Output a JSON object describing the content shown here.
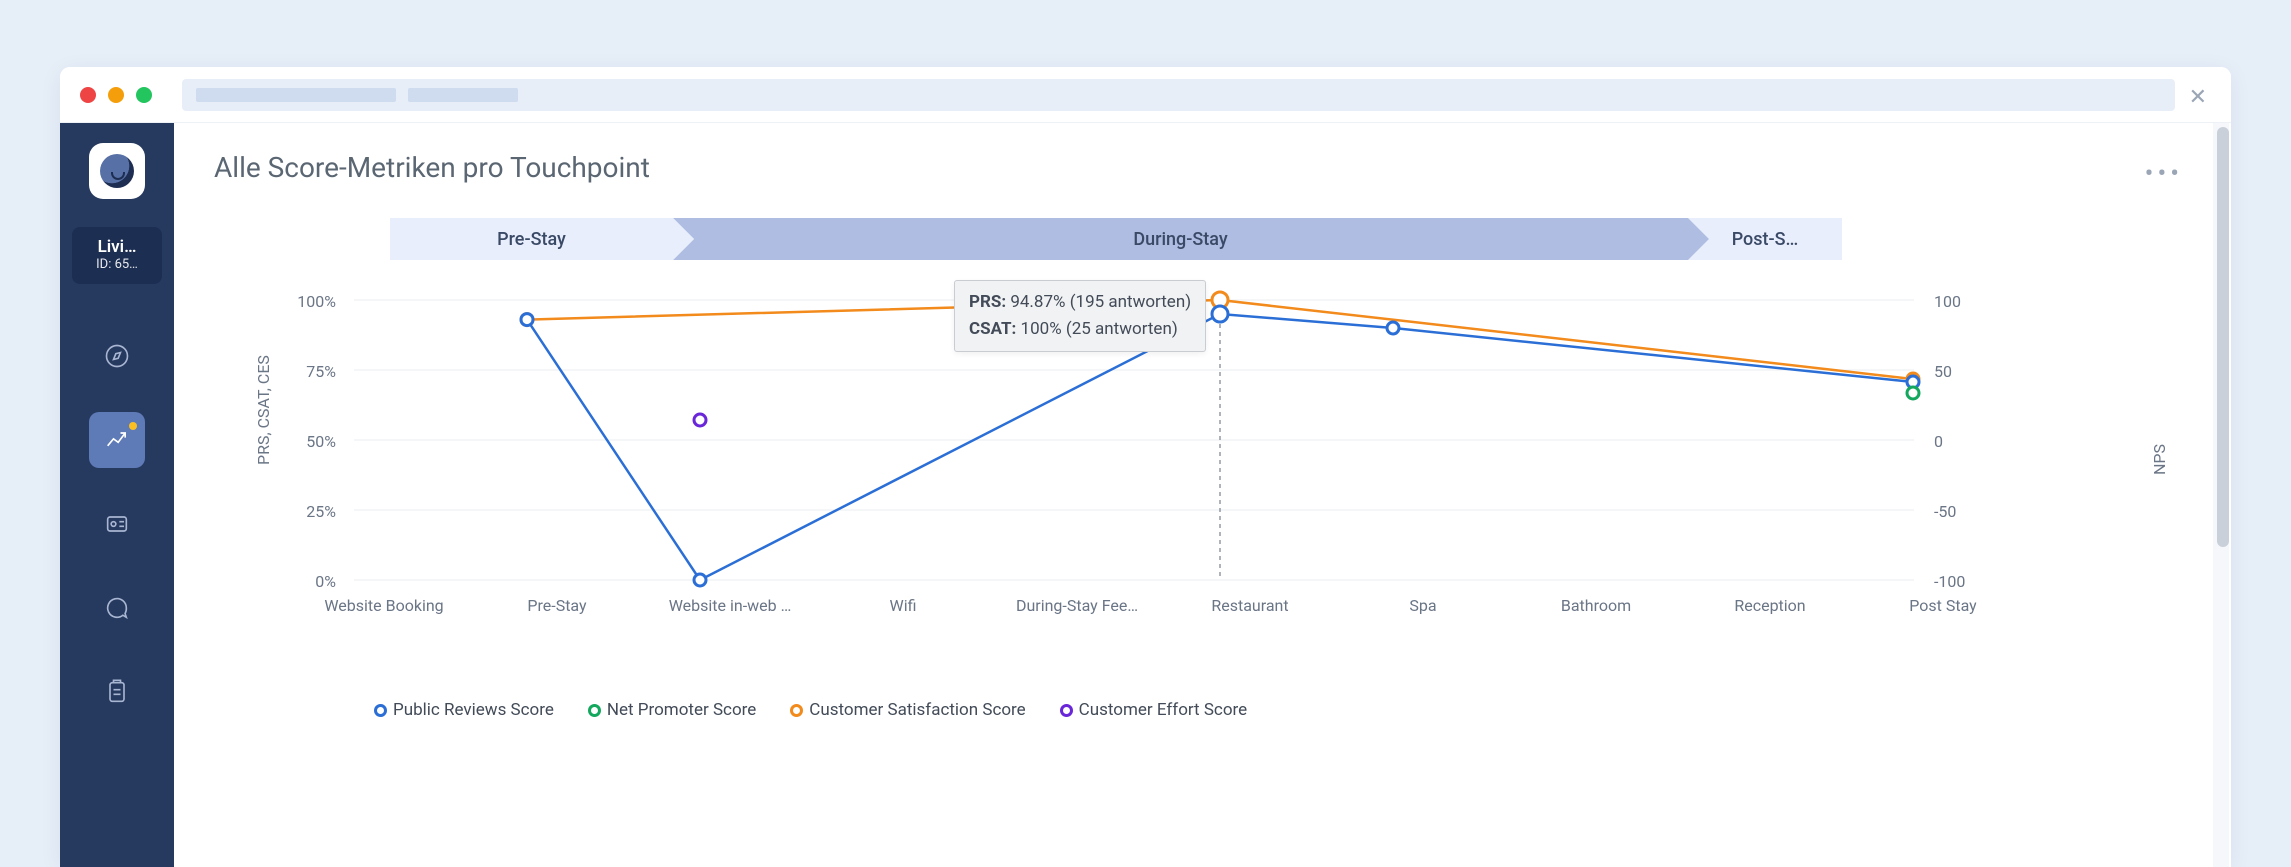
{
  "window": {
    "close_icon": "✕"
  },
  "sidebar": {
    "account": {
      "name": "Livi…",
      "id": "ID: 65…"
    }
  },
  "page": {
    "title": "Alle Score-Metriken pro Touchpoint"
  },
  "phases": [
    "Pre-Stay",
    "During-Stay",
    "Post-S…"
  ],
  "tooltip": {
    "prs_label": "PRS:",
    "prs_text": "94.87% (195 antworten)",
    "csat_label": "CSAT:",
    "csat_text": "100% (25 antworten)"
  },
  "legend": {
    "prs": "Public Reviews Score",
    "nps": "Net Promoter Score",
    "csat": "Customer Satisfaction Score",
    "ces": "Customer Effort Score"
  },
  "axes": {
    "left_label": "PRS, CSAT, CES",
    "right_label": "NPS",
    "left_ticks": [
      "0%",
      "25%",
      "50%",
      "75%",
      "100%"
    ],
    "right_ticks": [
      "-100",
      "-50",
      "0",
      "50",
      "100"
    ]
  },
  "chart_data": {
    "type": "line",
    "title": "Alle Score-Metriken pro Touchpoint",
    "xlabel": "",
    "ylabel_left": "PRS, CSAT, CES",
    "ylabel_right": "NPS",
    "left_ylim": [
      0,
      100
    ],
    "right_ylim": [
      -100,
      100
    ],
    "categories": [
      "Website Booking",
      "Pre-Stay",
      "Website in-web …",
      "Wifi",
      "During-Stay Fee…",
      "Restaurant",
      "Spa",
      "Bathroom",
      "Reception",
      "Post Stay"
    ],
    "phases": [
      {
        "name": "Pre-Stay",
        "from": "Website Booking",
        "to": "Pre-Stay"
      },
      {
        "name": "During-Stay",
        "from": "Website in-web …",
        "to": "Reception"
      },
      {
        "name": "Post-Stay",
        "from": "Post Stay",
        "to": "Post Stay"
      }
    ],
    "series": [
      {
        "name": "Public Reviews Score",
        "axis": "left",
        "color": "#2b6fd6",
        "values": [
          null,
          93,
          0,
          null,
          null,
          95,
          90,
          null,
          null,
          78
        ]
      },
      {
        "name": "Net Promoter Score",
        "axis": "right",
        "color": "#14a85e",
        "values": [
          null,
          null,
          null,
          null,
          null,
          null,
          null,
          null,
          null,
          50
        ]
      },
      {
        "name": "Customer Satisfaction Score",
        "axis": "left",
        "color": "#f28a1c",
        "values": [
          null,
          93,
          null,
          null,
          null,
          100,
          null,
          null,
          null,
          79
        ]
      },
      {
        "name": "Customer Effort Score",
        "axis": "left",
        "color": "#6a26d9",
        "values": [
          null,
          null,
          57,
          null,
          null,
          null,
          null,
          null,
          null,
          null
        ]
      }
    ],
    "tooltip_at": "Restaurant",
    "tooltip": [
      {
        "metric": "PRS",
        "value": "94.87%",
        "responses": 195,
        "suffix": "antworten"
      },
      {
        "metric": "CSAT",
        "value": "100%",
        "responses": 25,
        "suffix": "antworten"
      }
    ]
  }
}
